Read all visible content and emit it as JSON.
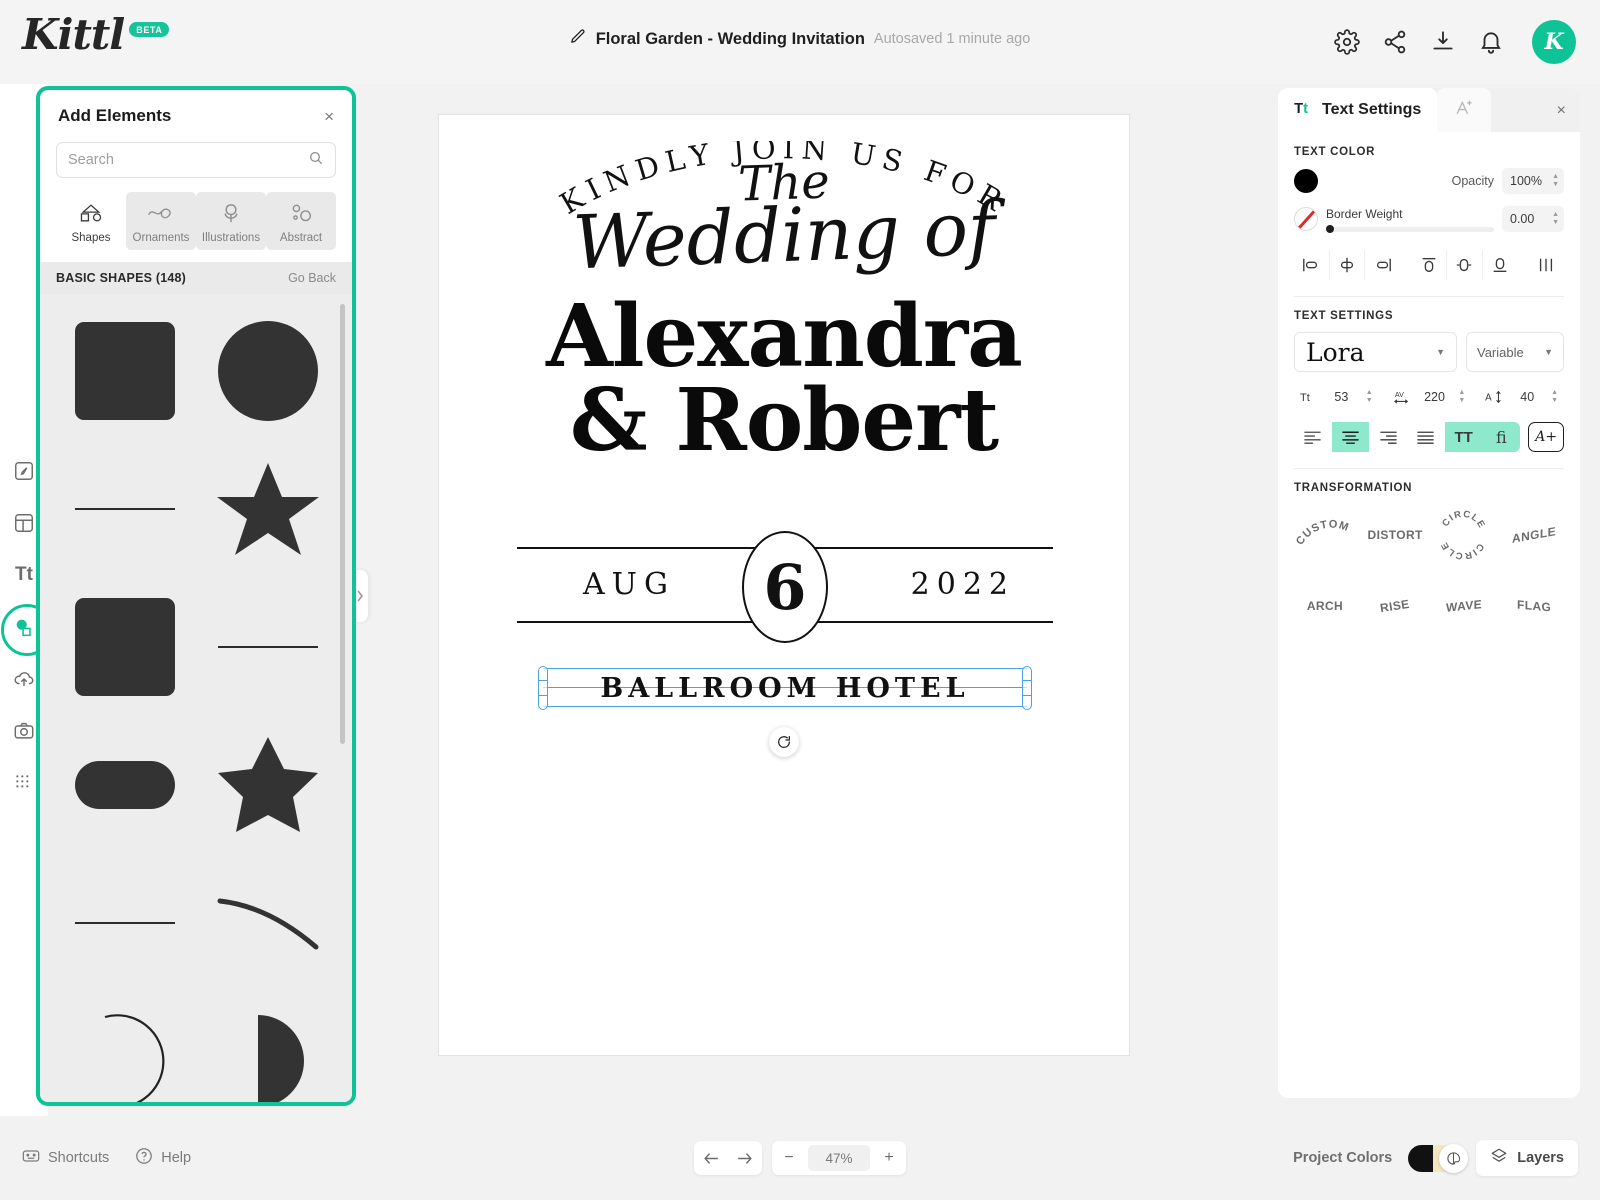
{
  "app": {
    "brand": "Kittl",
    "brand_badge": "BETA",
    "accent": "#0ec496",
    "selection_color": "#4aa3e0"
  },
  "header": {
    "doc_title": "Floral Garden - Wedding Invitation",
    "autosave": "Autosaved 1 minute ago",
    "edit_icon": "pencil-icon",
    "actions": [
      {
        "name": "settings-icon",
        "label": "Settings"
      },
      {
        "name": "share-icon",
        "label": "Share"
      },
      {
        "name": "download-icon",
        "label": "Download"
      },
      {
        "name": "notifications-icon",
        "label": "Notifications"
      }
    ],
    "avatar_initial": "K"
  },
  "rail": {
    "items": [
      {
        "name": "design-icon",
        "label": "Design",
        "active": false
      },
      {
        "name": "templates-icon",
        "label": "Templates",
        "active": false
      },
      {
        "name": "text-icon",
        "label": "Text",
        "active": false
      },
      {
        "name": "elements-icon",
        "label": "Elements",
        "active": true
      },
      {
        "name": "uploads-icon",
        "label": "Uploads",
        "active": false
      },
      {
        "name": "photos-icon",
        "label": "Photos",
        "active": false
      },
      {
        "name": "patterns-icon",
        "label": "Patterns",
        "active": false
      }
    ]
  },
  "add_elements": {
    "title": "Add Elements",
    "close_label": "×",
    "search": {
      "value": "",
      "placeholder": "Search"
    },
    "tabs": [
      {
        "label": "Shapes",
        "icon": "shapes-icon",
        "active": true
      },
      {
        "label": "Ornaments",
        "icon": "ornaments-icon",
        "active": false
      },
      {
        "label": "Illustrations",
        "icon": "illustrations-icon",
        "active": false
      },
      {
        "label": "Abstract",
        "icon": "abstract-icon",
        "active": false
      }
    ],
    "section_title": "BASIC SHAPES (148)",
    "go_back": "Go Back",
    "shapes": [
      {
        "name": "rounded-square-shape",
        "kind": "sq-round"
      },
      {
        "name": "circle-shape",
        "kind": "circle"
      },
      {
        "name": "horizontal-line-shape",
        "kind": "line"
      },
      {
        "name": "star-5-shape",
        "kind": "star"
      },
      {
        "name": "square-shape",
        "kind": "sq-round"
      },
      {
        "name": "thin-line-shape",
        "kind": "line"
      },
      {
        "name": "pill-shape",
        "kind": "pill"
      },
      {
        "name": "star-chunky-shape",
        "kind": "star2"
      },
      {
        "name": "rule-line-shape",
        "kind": "line"
      },
      {
        "name": "arc-curve-shape",
        "kind": "arc"
      },
      {
        "name": "open-circle-arc-shape",
        "kind": "arc-c"
      },
      {
        "name": "half-moon-shape",
        "kind": "halfmoon"
      }
    ]
  },
  "canvas": {
    "design": {
      "arc_line": "KINDLY JOIN US FOR",
      "script_small": "The",
      "script_large": "Wedding of",
      "name_line_1": "Alexandra",
      "name_line_2": "& Robert",
      "date_month": "AUG",
      "date_day": "6",
      "date_year": "2022",
      "venue": "BALLROOM HOTEL"
    },
    "rotate_handle": "rotate-icon"
  },
  "right_panel": {
    "tabs": [
      {
        "label": "Text Settings",
        "icon": "text-settings-icon",
        "active": true
      },
      {
        "label": "",
        "icon": "text-effects-icon",
        "active": false
      }
    ],
    "close_label": "×",
    "text_color": {
      "section_label": "TEXT COLOR",
      "fill_swatch": "#000000",
      "opacity_label": "Opacity",
      "opacity_value": "100%",
      "border_weight_label": "Border Weight",
      "border_weight_value": "0.00",
      "border_swatch": "none"
    },
    "align_buttons": [
      {
        "name": "align-left-icon",
        "label": "Align left"
      },
      {
        "name": "align-center-horizontal-icon",
        "label": "Align center horizontally"
      },
      {
        "name": "align-right-icon",
        "label": "Align right"
      },
      {
        "name": "align-top-icon",
        "label": "Align top"
      },
      {
        "name": "align-middle-icon",
        "label": "Align middle"
      },
      {
        "name": "align-bottom-icon",
        "label": "Align bottom"
      },
      {
        "name": "distribute-icon",
        "label": "Distribute"
      }
    ],
    "text_settings": {
      "section_label": "TEXT SETTINGS",
      "font_family": "Lora",
      "font_variant": "Variable",
      "font_size_label": "Tt",
      "font_size": "53",
      "letter_spacing_label": "AV",
      "letter_spacing": "220",
      "line_height_label": "A↕",
      "line_height": "40",
      "align_options": [
        {
          "name": "text-align-left-icon",
          "active": false
        },
        {
          "name": "text-align-center-icon",
          "active": true
        },
        {
          "name": "text-align-right-icon",
          "active": false
        },
        {
          "name": "text-align-justify-icon",
          "active": false
        }
      ],
      "uppercase_label": "TT",
      "uppercase_active": true,
      "ligature_label": "ﬁ",
      "ligature_active": true,
      "add_font_label": "A+"
    },
    "transformation": {
      "section_label": "TRANSFORMATION",
      "items": [
        {
          "label": "CUSTOM",
          "style": "arc"
        },
        {
          "label": "DISTORT",
          "style": "flat"
        },
        {
          "label": "CIRCLE",
          "style": "circle"
        },
        {
          "label": "ANGLE",
          "style": "flat"
        },
        {
          "label": "ARCH",
          "style": "flat"
        },
        {
          "label": "RISE",
          "style": "flat"
        },
        {
          "label": "WAVE",
          "style": "flat"
        },
        {
          "label": "FLAG",
          "style": "flat"
        }
      ]
    }
  },
  "footer": {
    "shortcuts_label": "Shortcuts",
    "help_label": "Help",
    "undo_icon": "undo-icon",
    "redo_icon": "redo-icon",
    "zoom_out": "−",
    "zoom_value": "47%",
    "zoom_in": "+",
    "project_colors_label": "Project Colors",
    "layers_label": "Layers"
  }
}
